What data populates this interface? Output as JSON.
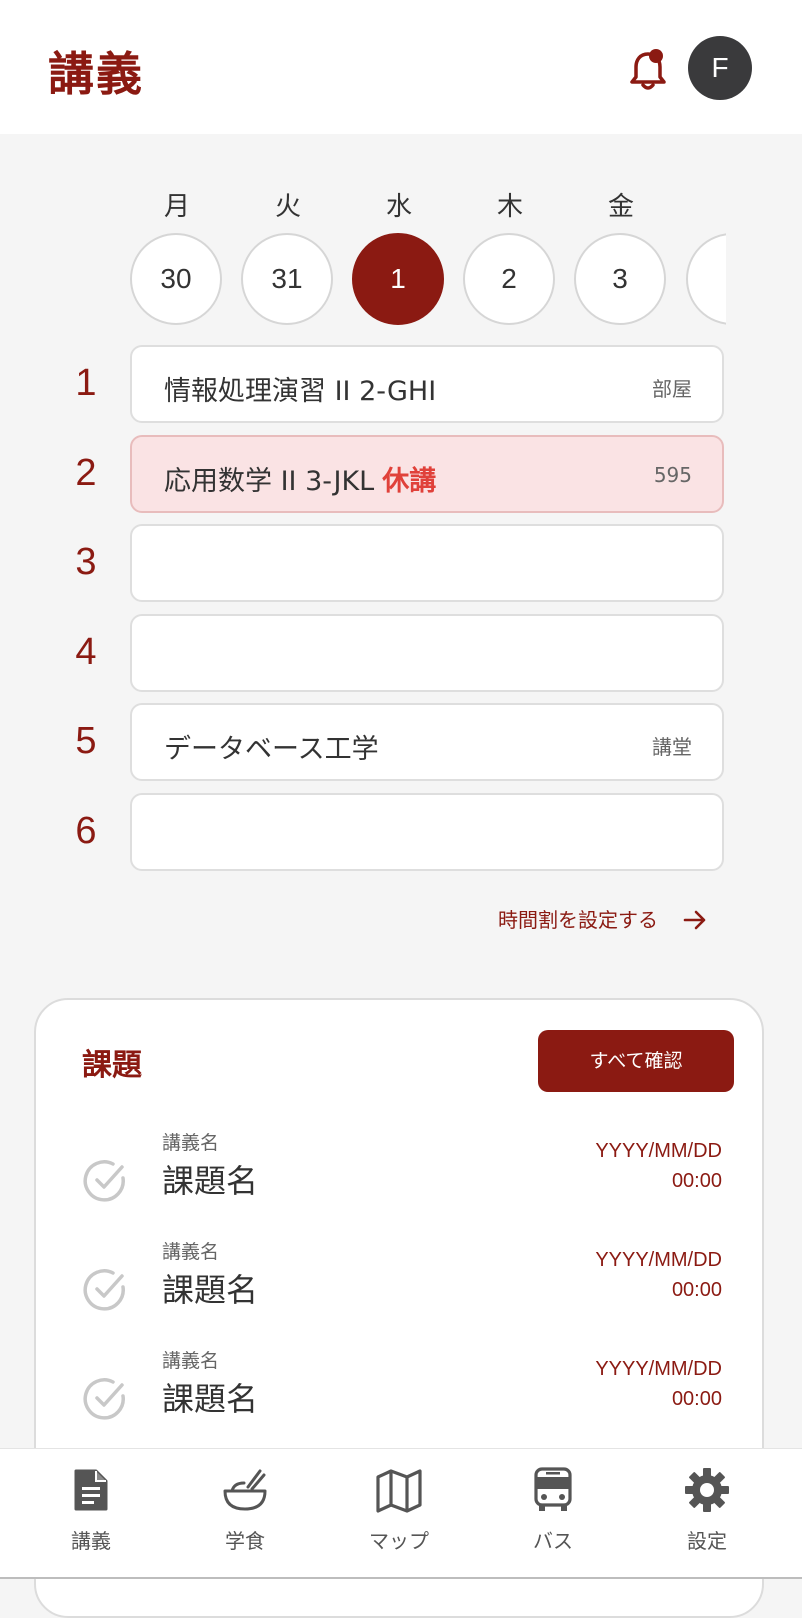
{
  "header": {
    "title": "講義",
    "avatar_initial": "F"
  },
  "week": {
    "weekdays": [
      "月",
      "火",
      "水",
      "木",
      "金"
    ],
    "days": [
      "30",
      "31",
      "1",
      "2",
      "3"
    ],
    "selected_index": 2
  },
  "periods": [
    {
      "num": "1",
      "course": "情報処理演習 II 2-GHI",
      "tag": "",
      "room": "部屋"
    },
    {
      "num": "2",
      "course": "応用数学 II 3-JKL",
      "tag": "休講",
      "room": "595"
    },
    {
      "num": "3",
      "course": "",
      "tag": "",
      "room": ""
    },
    {
      "num": "4",
      "course": "",
      "tag": "",
      "room": ""
    },
    {
      "num": "5",
      "course": "データベース工学",
      "tag": "",
      "room": "講堂"
    },
    {
      "num": "6",
      "course": "",
      "tag": "",
      "room": ""
    }
  ],
  "timetable_link": {
    "label": "時間割を設定する"
  },
  "tasks": {
    "title": "課題",
    "confirm_all": "すべて確認",
    "items": [
      {
        "course": "講義名",
        "name": "課題名",
        "due_date": "YYYY/MM/DD",
        "due_time": "00:00"
      },
      {
        "course": "講義名",
        "name": "課題名",
        "due_date": "YYYY/MM/DD",
        "due_time": "00:00"
      },
      {
        "course": "講義名",
        "name": "課題名",
        "due_date": "YYYY/MM/DD",
        "due_time": "00:00"
      }
    ]
  },
  "nav": [
    {
      "label": "講義",
      "icon": "document-icon"
    },
    {
      "label": "学食",
      "icon": "bowl-icon"
    },
    {
      "label": "マップ",
      "icon": "map-icon"
    },
    {
      "label": "バス",
      "icon": "bus-icon"
    },
    {
      "label": "設定",
      "icon": "gear-icon"
    }
  ],
  "colors": {
    "accent": "#8b1a12",
    "cancel_text": "#e0413a",
    "cancel_bg": "#fae3e4",
    "background": "#f5f5f5"
  }
}
